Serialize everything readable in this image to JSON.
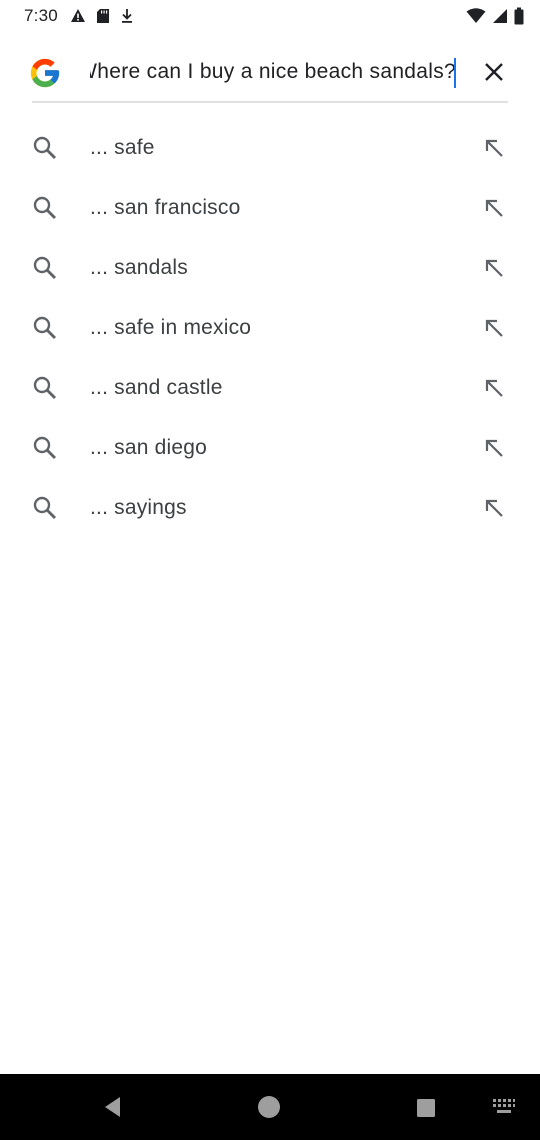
{
  "status_bar": {
    "time": "7:30",
    "left_icons": [
      "alert-icon",
      "sd-card-icon",
      "download-icon"
    ],
    "right_icons": [
      "wifi-icon",
      "signal-icon",
      "battery-icon"
    ]
  },
  "search": {
    "query": "Where can I buy a nice beach sandals?",
    "logo": "google-g-icon",
    "clear_icon": "close-icon"
  },
  "suggestions": [
    {
      "label": "... safe"
    },
    {
      "label": "... san francisco"
    },
    {
      "label": "... sandals"
    },
    {
      "label": "... safe in mexico"
    },
    {
      "label": "... sand castle"
    },
    {
      "label": "... san diego"
    },
    {
      "label": "... sayings"
    }
  ],
  "nav_bar": {
    "buttons": [
      "back-icon",
      "home-icon",
      "recents-icon",
      "keyboard-icon"
    ]
  },
  "colors": {
    "accent": "#1a73e8",
    "text": "#202124",
    "icon_gray": "#5f6368",
    "nav_bg": "#000000"
  }
}
